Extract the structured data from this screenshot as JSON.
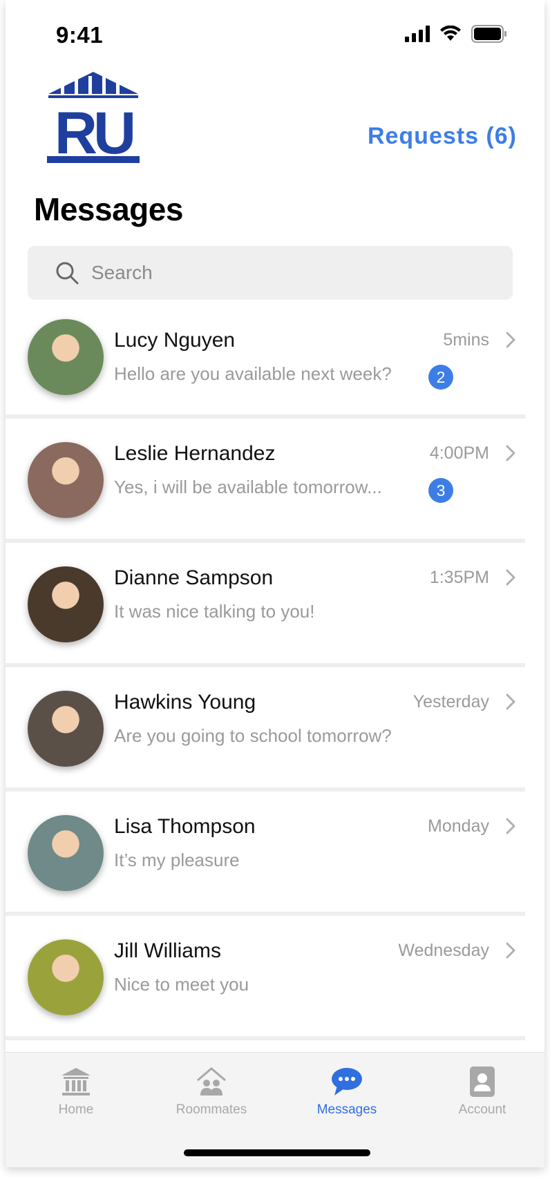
{
  "status_bar": {
    "time": "9:41"
  },
  "header": {
    "logo_text": "RU",
    "requests_label": "Requests (6)",
    "title": "Messages"
  },
  "search": {
    "placeholder": "Search"
  },
  "conversations": [
    {
      "name": "Lucy Nguyen",
      "preview": "Hello are you available next week?",
      "time": "5mins",
      "unread": "2",
      "avatar_color": "#6b8a5c"
    },
    {
      "name": "Leslie Hernandez",
      "preview": "Yes, i will be available tomorrow...",
      "time": "4:00PM",
      "unread": "3",
      "avatar_color": "#8a6a5e"
    },
    {
      "name": "Dianne Sampson",
      "preview": "It was nice talking to you!",
      "time": "1:35PM",
      "unread": "",
      "avatar_color": "#4a3a2c"
    },
    {
      "name": "Hawkins Young",
      "preview": "Are you going to school tomorrow?",
      "time": "Yesterday",
      "unread": "",
      "avatar_color": "#5a5048"
    },
    {
      "name": "Lisa Thompson",
      "preview": "It’s my pleasure",
      "time": "Monday",
      "unread": "",
      "avatar_color": "#6f8a88"
    },
    {
      "name": "Jill Williams",
      "preview": "Nice to meet you",
      "time": "Wednesday",
      "unread": "",
      "avatar_color": "#9aa23c"
    }
  ],
  "tabbar": {
    "items": [
      {
        "label": "Home",
        "icon": "bank-icon"
      },
      {
        "label": "Roommates",
        "icon": "roommates-icon"
      },
      {
        "label": "Messages",
        "icon": "chat-bubble-icon",
        "active": true
      },
      {
        "label": "Account",
        "icon": "account-icon"
      }
    ]
  },
  "colors": {
    "accent": "#3d7ee6",
    "logo_blue": "#1f3f9e",
    "inactive": "#a8a8a8"
  }
}
